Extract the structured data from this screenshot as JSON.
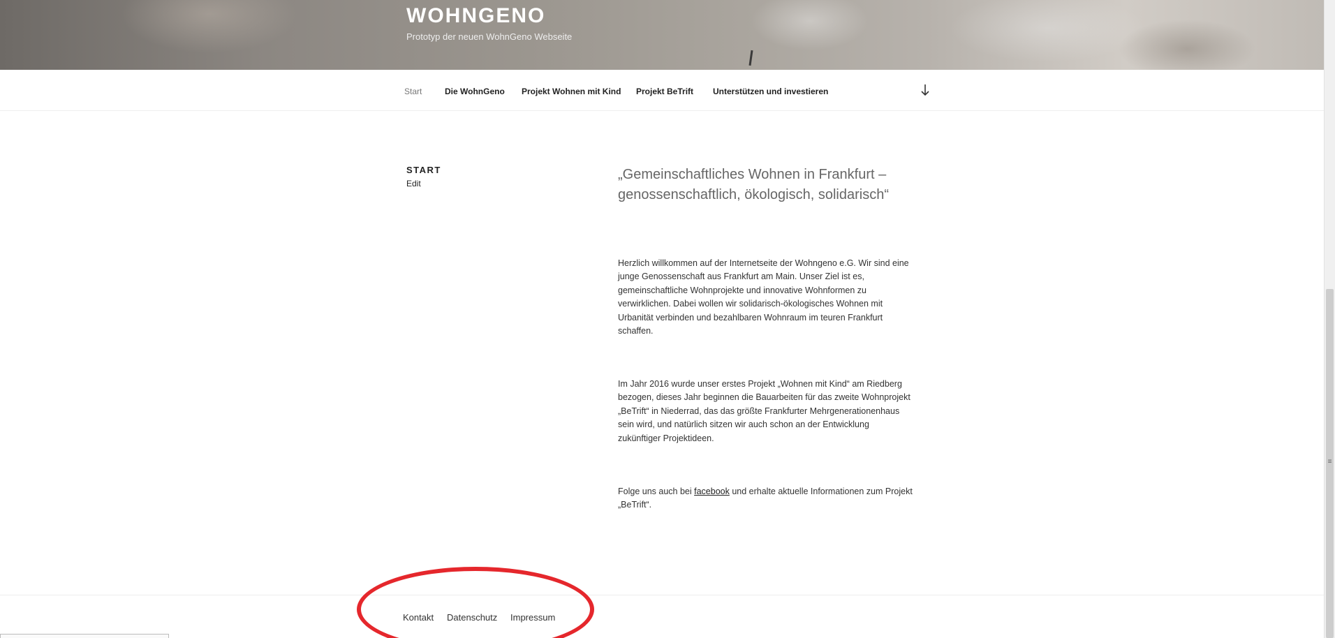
{
  "header": {
    "site_title": "WOHNGENO",
    "site_description": "Prototyp der neuen WohnGeno Webseite"
  },
  "nav": {
    "items": [
      {
        "label": "Start",
        "active": true
      },
      {
        "label": "Die WohnGeno"
      },
      {
        "label": "Projekt Wohnen mit Kind"
      },
      {
        "label": "Projekt BeTrift"
      },
      {
        "label": "Unterstützen und investieren"
      }
    ],
    "scroll_icon": "arrow-down-icon"
  },
  "content": {
    "page_title": "START",
    "edit_label": "Edit",
    "lead": "„Gemeinschaftliches Wohnen in Frankfurt – genossenschaftlich, ökologisch, solidarisch“",
    "paragraph_1": "Herzlich willkommen auf der Internetseite der Wohngeno e.G. Wir sind eine junge Genossenschaft aus Frankfurt am Main. Unser Ziel ist es, gemeinschaftliche Wohnprojekte und innovative Wohnformen zu verwirklichen. Dabei wollen wir solidarisch-ökologisches Wohnen mit Urbanität verbinden und bezahlbaren Wohnraum im teuren Frankfurt schaffen.",
    "paragraph_2": "Im Jahr 2016 wurde unser erstes Projekt „Wohnen mit Kind“ am Riedberg bezogen, dieses Jahr beginnen die Bauarbeiten für das zweite Wohnprojekt „BeTrift“ in Niederrad, das das größte Frankfurter Mehrgenerationenhaus sein wird, und natürlich sitzen wir auch schon an der Entwicklung zukünftiger Projektideen.",
    "paragraph_3_before": "Folge uns auch bei ",
    "paragraph_3_link": "facebook",
    "paragraph_3_after": " und erhalte aktuelle Informationen zum Projekt „BeTrift“."
  },
  "footer": {
    "links": [
      "Kontakt",
      "Datenschutz",
      "Impressum"
    ]
  },
  "colors": {
    "annotation_ellipse": "#e5272c",
    "nav_active": "#777777",
    "lead_text": "#666666"
  }
}
